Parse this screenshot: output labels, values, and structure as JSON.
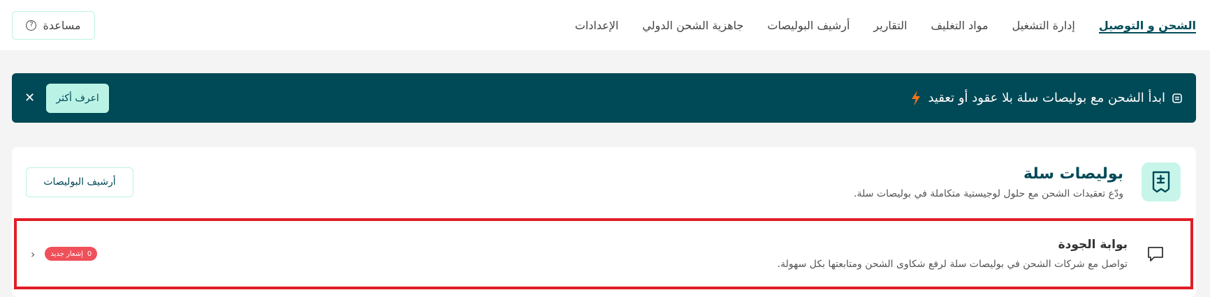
{
  "topbar": {
    "tabs": [
      {
        "label": "الشحن و التوصيل",
        "active": true
      },
      {
        "label": "إدارة التشغيل",
        "active": false
      },
      {
        "label": "مواد التغليف",
        "active": false
      },
      {
        "label": "التقارير",
        "active": false
      },
      {
        "label": "أرشيف البوليصات",
        "active": false
      },
      {
        "label": "جاهزية الشحن الدولي",
        "active": false
      },
      {
        "label": "الإعدادات",
        "active": false
      }
    ],
    "help_label": "مساعدة",
    "help_icon": "question-circle-icon"
  },
  "banner": {
    "text": "ابدأ الشحن مع بوليصات سلة بلا عقود أو تعقيد",
    "icon": "policy-icon",
    "accent_icon": "lightning-icon",
    "button_label": "اعرف أكثر",
    "close_icon": "close-icon"
  },
  "card": {
    "title": "بوليصات سلة",
    "subtitle": "ودّع تعقيدات الشحن مع حلول لوجيستية متكاملة في بوليصات سلة.",
    "archive_button": "أرشيف البوليصات",
    "icon": "policy-list-icon"
  },
  "portal": {
    "title": "بوابة الجودة",
    "subtitle": "تواصل مع شركات الشحن في بوليصات سلة لرفع شكاوى الشحن ومتابعتها بكل سهولة.",
    "icon": "chat-icon",
    "badge_count": "0",
    "badge_label": "إشعار جديد",
    "chevron_icon": "chevron-left-icon"
  },
  "colors": {
    "brand_dark": "#004956",
    "mint": "#baf3e6",
    "badge_red": "#f0505a",
    "highlight_red": "#e11d26",
    "lightning": "#f97316"
  }
}
